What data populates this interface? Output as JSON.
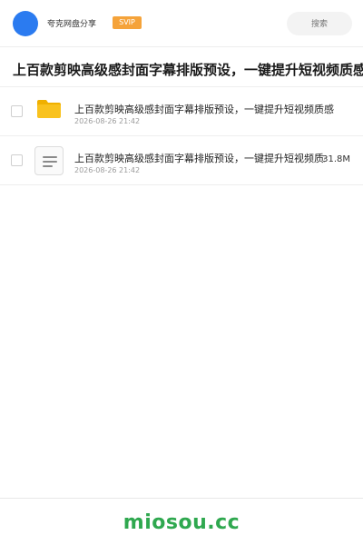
{
  "colors": {
    "avatar": "#2b7bf0",
    "svip_bg": "#f5a33a",
    "folder": "#f9c21e",
    "folder_tab": "#f0b000",
    "footer_logo": "#2fa84f"
  },
  "header": {
    "brand": "夸克网盘分享",
    "badge": "SVIP",
    "search_placeholder": "搜索"
  },
  "share": {
    "title": "上百款剪映高级感封面字幕排版预设，一键提升短视频质感"
  },
  "files": [
    {
      "icon": "folder-icon",
      "name": "上百款剪映高级感封面字幕排版预设，一键提升短视频质感",
      "date": "2026-08-26 21:42",
      "size": ""
    },
    {
      "icon": "document-icon",
      "name": "上百款剪映高级感封面字幕排版预设，一键提升短视频质感",
      "date": "2026-08-26 21:42",
      "size": "31.8M"
    }
  ],
  "footer": {
    "logo": "miosou.cc"
  }
}
